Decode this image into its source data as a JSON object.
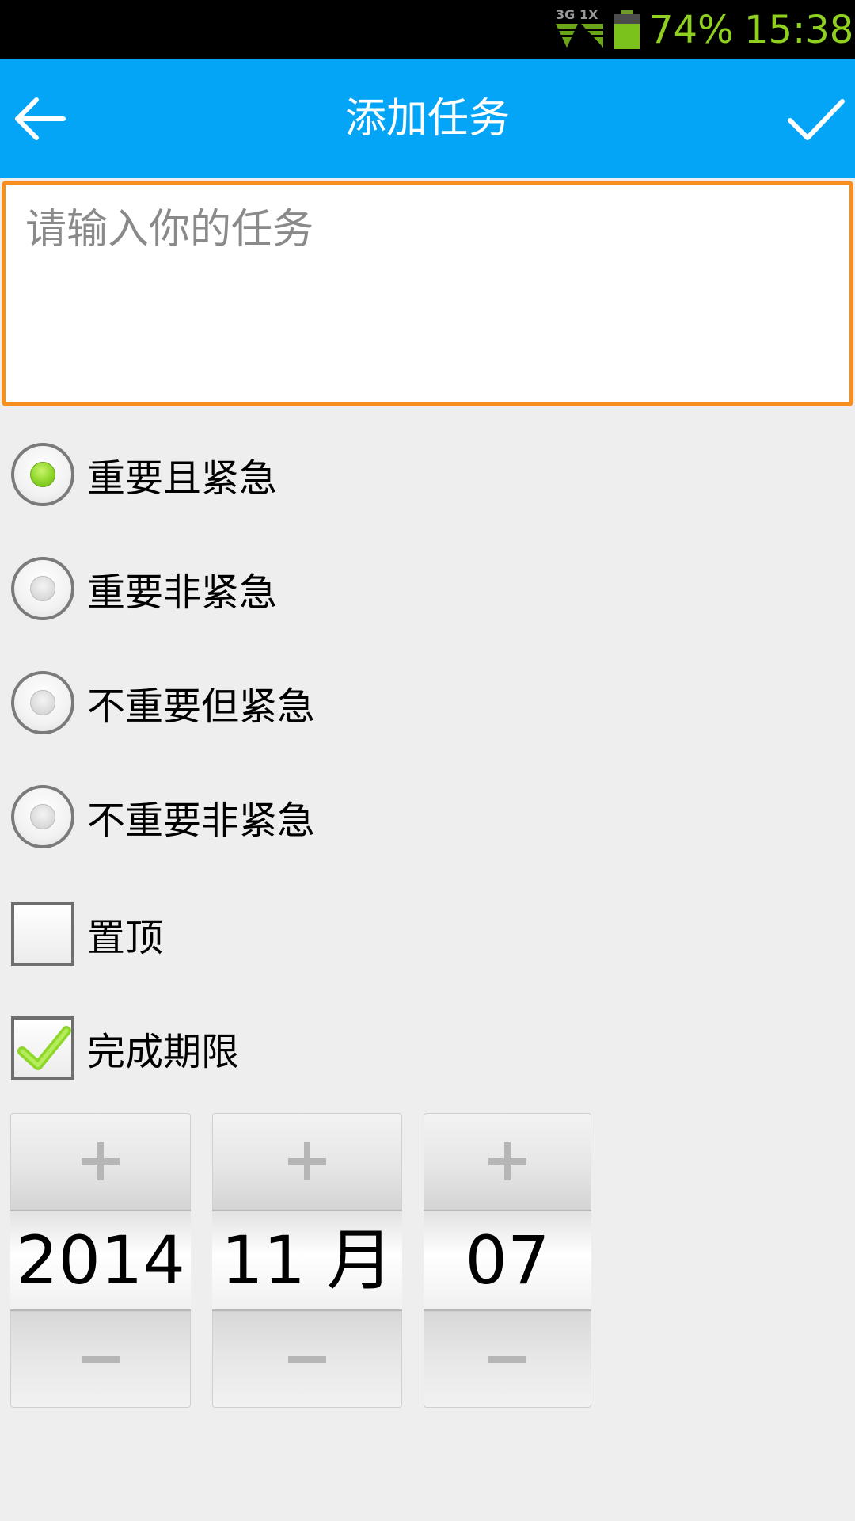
{
  "status_bar": {
    "network": "3G 1X",
    "battery_percent": "74%",
    "time": "15:38",
    "text_color": "#8fcf1f"
  },
  "app_bar": {
    "title": "添加任务",
    "back_icon": "arrow-left-icon",
    "confirm_icon": "checkmark-icon",
    "background": "#04a4f7"
  },
  "task_input": {
    "placeholder": "请输入你的任务",
    "value": "",
    "border_color": "#f68f1e"
  },
  "priority_options": [
    {
      "label": "重要且紧急",
      "selected": true
    },
    {
      "label": "重要非紧急",
      "selected": false
    },
    {
      "label": "不重要但紧急",
      "selected": false
    },
    {
      "label": "不重要非紧急",
      "selected": false
    }
  ],
  "pin_top": {
    "label": "置顶",
    "checked": false
  },
  "deadline": {
    "label": "完成期限",
    "checked": true
  },
  "date_picker": {
    "year": "2014",
    "month": "11 月",
    "day": "07",
    "plus_icon": "plus-icon",
    "minus_icon": "minus-icon"
  }
}
